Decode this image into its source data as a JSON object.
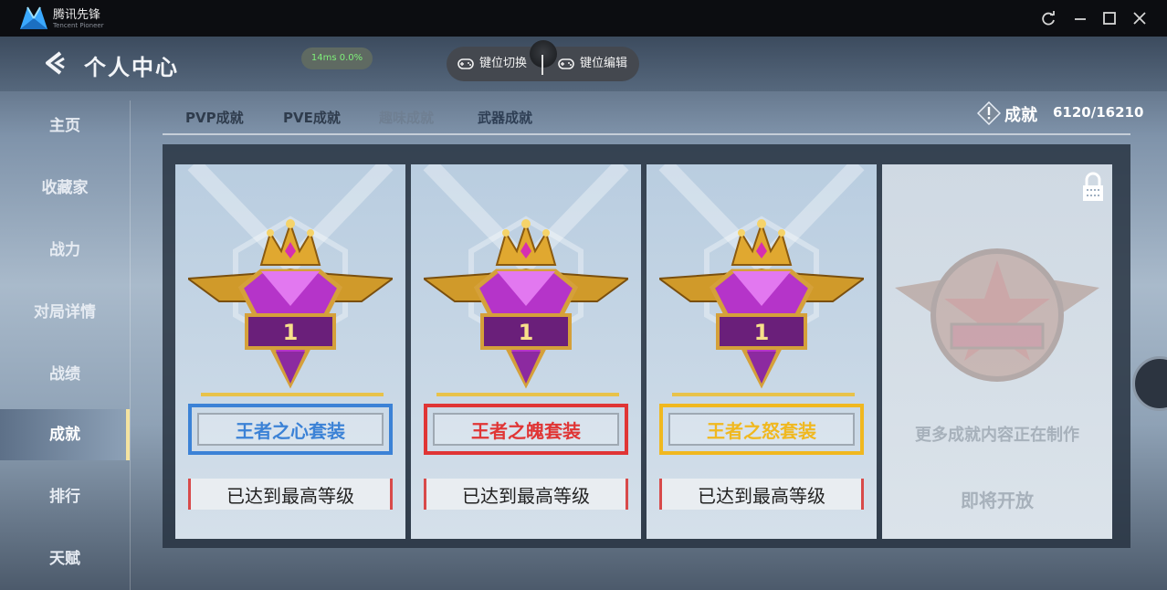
{
  "titlebar": {
    "brand": "腾讯先锋",
    "brand_sub": "Tencent Pioneer"
  },
  "header": {
    "title": "个人中心",
    "ping": "14ms  0.0%",
    "key_switch": "键位切换",
    "key_edit": "键位编辑"
  },
  "sidebar": {
    "items": [
      {
        "label": "主页"
      },
      {
        "label": "收藏家"
      },
      {
        "label": "战力"
      },
      {
        "label": "对局详情"
      },
      {
        "label": "战绩"
      },
      {
        "label": "成就",
        "active": true
      },
      {
        "label": "排行"
      },
      {
        "label": "天赋"
      }
    ]
  },
  "tabs": [
    {
      "label": "PVP成就"
    },
    {
      "label": "PVE成就"
    },
    {
      "label": "趣味成就"
    },
    {
      "label": "武器成就",
      "active": true
    }
  ],
  "achievement": {
    "label": "成就",
    "count": "6120/16210"
  },
  "cards": [
    {
      "name": "王者之心套装",
      "level_text": "已达到最高等级",
      "badge_number": "1",
      "color": "#3b82d6"
    },
    {
      "name": "王者之魄套装",
      "level_text": "已达到最高等级",
      "badge_number": "1",
      "color": "#e03535"
    },
    {
      "name": "王者之怒套装",
      "level_text": "已达到最高等级",
      "badge_number": "1",
      "color": "#f0b81f"
    }
  ],
  "locked_card": {
    "text": "更多成就内容正在制作",
    "subtext": "即将开放"
  },
  "colors": {
    "titlebar": "#0c0d11",
    "active_side": "#8ea2b8",
    "gold": "#e8c24a"
  }
}
